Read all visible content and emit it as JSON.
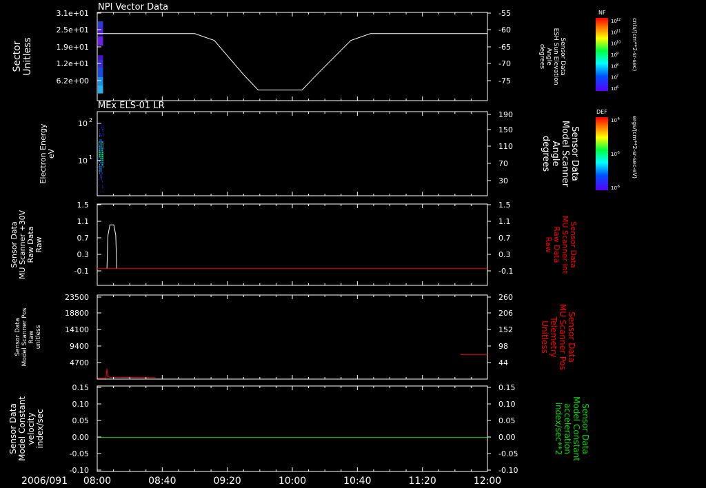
{
  "colors": {
    "frame": "#ffffff",
    "axis_text": "#ffffff",
    "red": "#ff0000",
    "green": "#00e000",
    "background": "#000000"
  },
  "time_axis": {
    "date": "2006/091",
    "ticks": [
      "08:00",
      "08:40",
      "09:20",
      "10:00",
      "10:40",
      "11:20",
      "12:00"
    ]
  },
  "panels": {
    "p1": {
      "title": "NPI Vector Data",
      "left_label": [
        "Sector",
        "Unitless"
      ],
      "left_ticks": [
        "3.1e+01",
        "2.5e+01",
        "1.9e+01",
        "1.2e+01",
        "6.2e+00"
      ],
      "right_label": [
        "Sensor Data",
        "ESH Sun Elevation",
        "Angle",
        "degrees"
      ],
      "right_ticks": [
        "-55",
        "-60",
        "-65",
        "-70",
        "-75"
      ]
    },
    "p2": {
      "title": "MEx ELS-01 LR",
      "left_label": [
        "Electron Energy",
        "eV"
      ],
      "left_ticks": [
        "10",
        "10"
      ],
      "left_tick_exps": [
        "2",
        "1"
      ],
      "right_label": [
        "Sensor Data",
        "Model Scanner",
        "Angle",
        "degrees"
      ],
      "right_ticks": [
        "190",
        "150",
        "110",
        "70",
        "30"
      ]
    },
    "p3": {
      "left_label": [
        "Sensor Data",
        "MU Scanner +30V",
        "Raw Data",
        "Raw"
      ],
      "left_ticks": [
        "1.5",
        "1.1",
        "0.7",
        "0.3",
        "-0.1"
      ],
      "right_label": [
        "Sensor Data",
        "MU Scanner Int",
        "Raw Data",
        "Raw"
      ],
      "right_ticks": [
        "1.5",
        "1.1",
        "0.7",
        "0.3",
        "-0.1"
      ]
    },
    "p4": {
      "left_label": [
        "Sensor Data",
        "Model Scanner Pos",
        "Raw",
        "unitless"
      ],
      "left_ticks": [
        "23500",
        "18800",
        "14100",
        "9400",
        "4700"
      ],
      "right_label": [
        "Sensor Data",
        "MU Scanner Pos",
        "Telemetry",
        "Unitless"
      ],
      "right_ticks": [
        "260",
        "206",
        "152",
        "98",
        "44"
      ]
    },
    "p5": {
      "left_label": [
        "Sensor Data",
        "Model Constant",
        "velocity",
        "index/sec"
      ],
      "left_ticks": [
        "0.15",
        "0.10",
        "0.05",
        "0.00",
        "-0.05",
        "-0.10"
      ],
      "right_label": [
        "Sensor Data",
        "Model Constant",
        "acceleration",
        "index/sec**2"
      ],
      "right_ticks": [
        "0.15",
        "0.10",
        "0.05",
        "0.00",
        "-0.05",
        "-0.10"
      ]
    }
  },
  "colorbars": {
    "cb1": {
      "label": "NF",
      "unit": "cnts/(cm**2-sr-sec)",
      "ticks": [
        "10",
        "10",
        "10",
        "10",
        "10",
        "10",
        "10"
      ],
      "tick_exps": [
        "12",
        "11",
        "10",
        "9",
        "8",
        "7",
        "6"
      ]
    },
    "cb2": {
      "label": "DEF",
      "unit": "ergs/(cm**2-sr-sec-eV)",
      "ticks": [
        "10",
        "10",
        "10"
      ],
      "tick_exps": [
        "-4",
        "-5",
        "-6"
      ]
    }
  },
  "chart_data": [
    {
      "panel": "p1",
      "type": "line",
      "x_unit": "hours",
      "xlim": [
        8.0,
        12.0
      ],
      "ylim": [
        -53.8,
        -79.6
      ],
      "series": [
        {
          "axis": "right",
          "x": [
            8.0,
            9.0,
            9.2,
            9.5,
            9.65,
            10.1,
            10.25,
            10.6,
            10.8,
            12.0
          ],
          "y": [
            -60,
            -60,
            -62,
            -72,
            -76.5,
            -76.5,
            -72,
            -62,
            -60,
            -60
          ]
        }
      ]
    },
    {
      "panel": "p3",
      "type": "line",
      "x_unit": "hours",
      "xlim": [
        8.0,
        12.0
      ],
      "ylim": [
        -0.45,
        1.5
      ],
      "series": [
        {
          "axis": "left",
          "x": [
            8.1,
            8.11,
            8.13,
            8.17,
            8.19,
            8.2
          ],
          "y": [
            -0.05,
            0.75,
            1.0,
            1.0,
            0.75,
            -0.05
          ]
        },
        {
          "axis": "right",
          "x": [
            8.0,
            12.0
          ],
          "y": [
            -0.05,
            -0.05
          ]
        }
      ]
    },
    {
      "panel": "p4",
      "type": "line",
      "x_unit": "hours",
      "xlim": [
        8.0,
        12.0
      ],
      "ylim_left": [
        0,
        23500
      ],
      "ylim_right": [
        0,
        260
      ],
      "series": [
        {
          "axis": "left",
          "x": [
            8.0,
            8.09,
            8.1,
            8.11,
            8.13,
            8.6
          ],
          "y": [
            300,
            300,
            2900,
            700,
            500,
            400
          ]
        },
        {
          "axis": "right",
          "x": [
            11.72,
            12.0
          ],
          "y": [
            76,
            76
          ]
        }
      ]
    },
    {
      "panel": "p5",
      "type": "line",
      "x_unit": "hours",
      "xlim": [
        8.0,
        12.0
      ],
      "ylim": [
        -0.1,
        0.15
      ],
      "series": [
        {
          "axis": "right",
          "x": [
            8.0,
            12.0
          ],
          "y": [
            0.0,
            0.0
          ]
        }
      ]
    },
    {
      "panel": "p1",
      "type": "heatmap",
      "x_range_hours": [
        8.0,
        8.06
      ],
      "rows": [
        {
          "y": 25.5,
          "h": 2.5,
          "color": "#2a3bd6"
        },
        {
          "y": 23.0,
          "h": 2.5,
          "color": "#5020e0"
        },
        {
          "y": 19.0,
          "h": 3.5,
          "color": "#6a22e6"
        },
        {
          "y": 14.0,
          "h": 1.5,
          "color": "#4a10d0"
        },
        {
          "y": 11.0,
          "h": 3.0,
          "color": "#3a2ad8"
        },
        {
          "y": 7.5,
          "h": 3.5,
          "color": "#1a4ae0"
        },
        {
          "y": 4.5,
          "h": 3.0,
          "color": "#1a8ee8"
        },
        {
          "y": 1.5,
          "h": 3.0,
          "color": "#26b2ee"
        }
      ]
    },
    {
      "panel": "p2",
      "type": "heatmap",
      "x_range_hours": [
        8.0,
        8.06
      ],
      "energy_range_eV": [
        1.5,
        150
      ],
      "colormap": [
        "#4000c0",
        "#2030e0",
        "#1090ff",
        "#10e0e0",
        "#20ff90"
      ]
    }
  ]
}
